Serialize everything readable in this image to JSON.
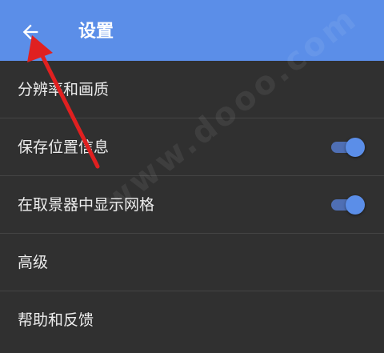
{
  "header": {
    "title": "设置",
    "back_icon": "arrow-left-icon",
    "background_color": "#5b8ee8"
  },
  "settings": {
    "items": [
      {
        "label": "分辨率和画质",
        "has_toggle": false
      },
      {
        "label": "保存位置信息",
        "has_toggle": true,
        "toggle_on": true
      },
      {
        "label": "在取景器中显示网格",
        "has_toggle": true,
        "toggle_on": true
      },
      {
        "label": "高级",
        "has_toggle": false
      },
      {
        "label": "帮助和反馈",
        "has_toggle": false
      }
    ]
  },
  "watermark": {
    "text": "www.dooo.com"
  },
  "annotation": {
    "icon": "red-arrow-annotation-icon",
    "color": "#e02020"
  }
}
